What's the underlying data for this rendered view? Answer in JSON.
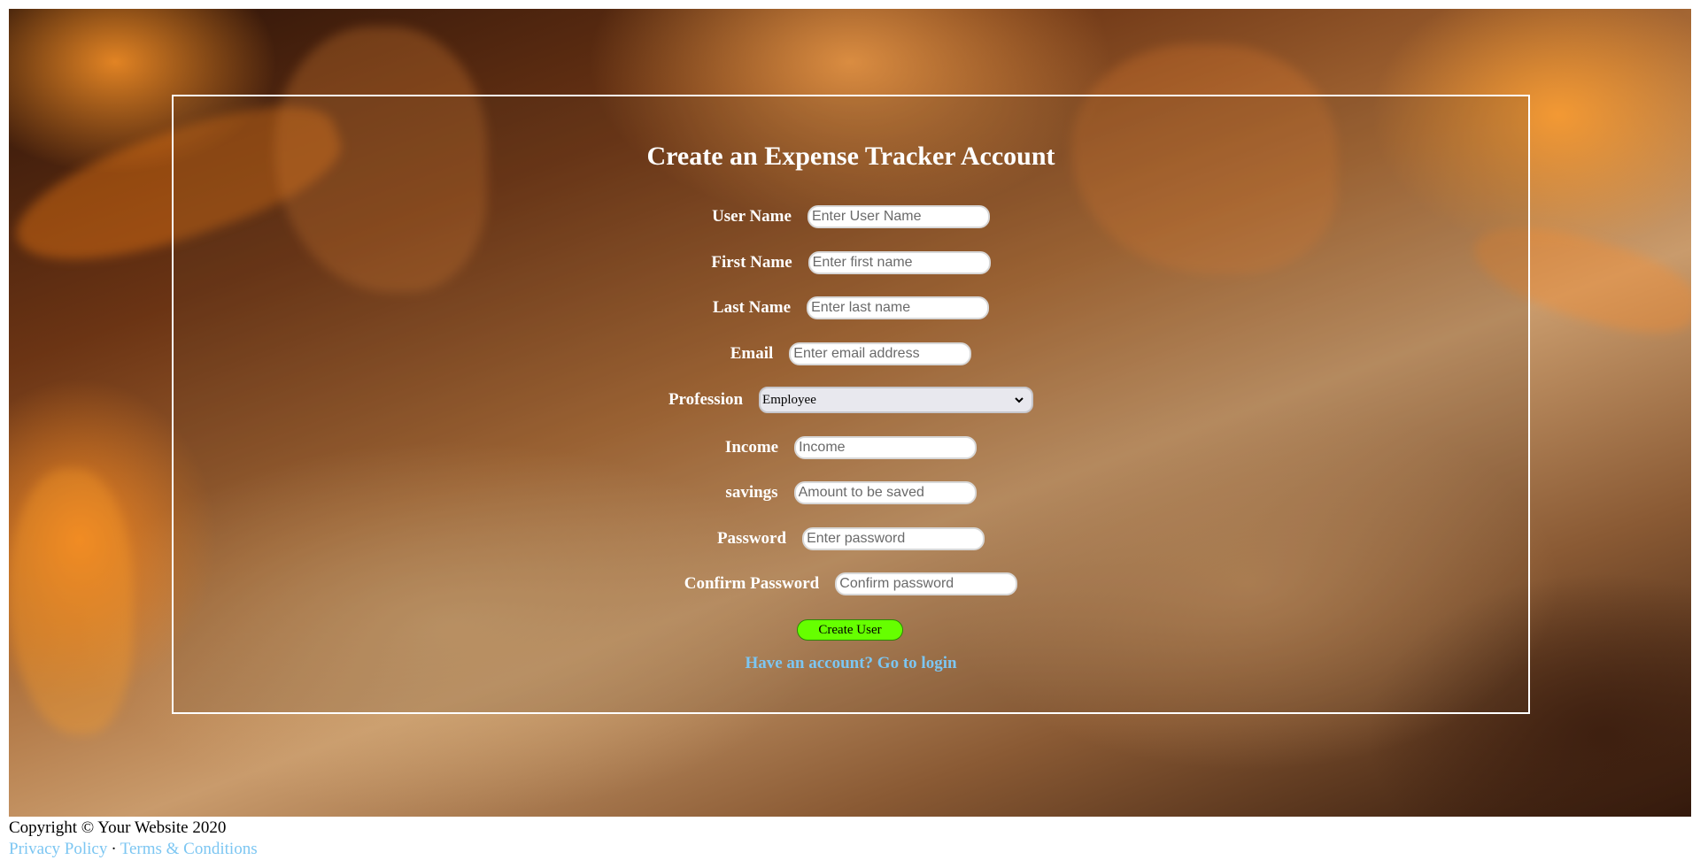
{
  "form": {
    "title": "Create an Expense Tracker Account",
    "fields": {
      "username": {
        "label": "User Name",
        "placeholder": "Enter User Name",
        "value": ""
      },
      "firstname": {
        "label": "First Name",
        "placeholder": "Enter first name",
        "value": ""
      },
      "lastname": {
        "label": "Last Name",
        "placeholder": "Enter last name",
        "value": ""
      },
      "email": {
        "label": "Email",
        "placeholder": "Enter email address",
        "value": ""
      },
      "profession": {
        "label": "Profession",
        "selected": "Employee",
        "icon": "chevron-down-icon"
      },
      "income": {
        "label": "Income",
        "placeholder": "Income",
        "value": ""
      },
      "savings": {
        "label": "savings",
        "placeholder": "Amount to be saved",
        "value": ""
      },
      "password": {
        "label": "Password",
        "placeholder": "Enter password",
        "value": ""
      },
      "confirm_password": {
        "label": "Confirm Password",
        "placeholder": "Confirm password",
        "value": ""
      }
    },
    "submit_label": "Create User",
    "login_link": "Have an account? Go to login"
  },
  "footer": {
    "copyright": "Copyright © Your Website 2020",
    "privacy_link": "Privacy Policy",
    "separator": "·",
    "terms_link": "Terms & Conditions"
  },
  "colors": {
    "button_bg": "#66ff00",
    "link": "#7cc6f2",
    "panel_border": "#ffffff"
  }
}
